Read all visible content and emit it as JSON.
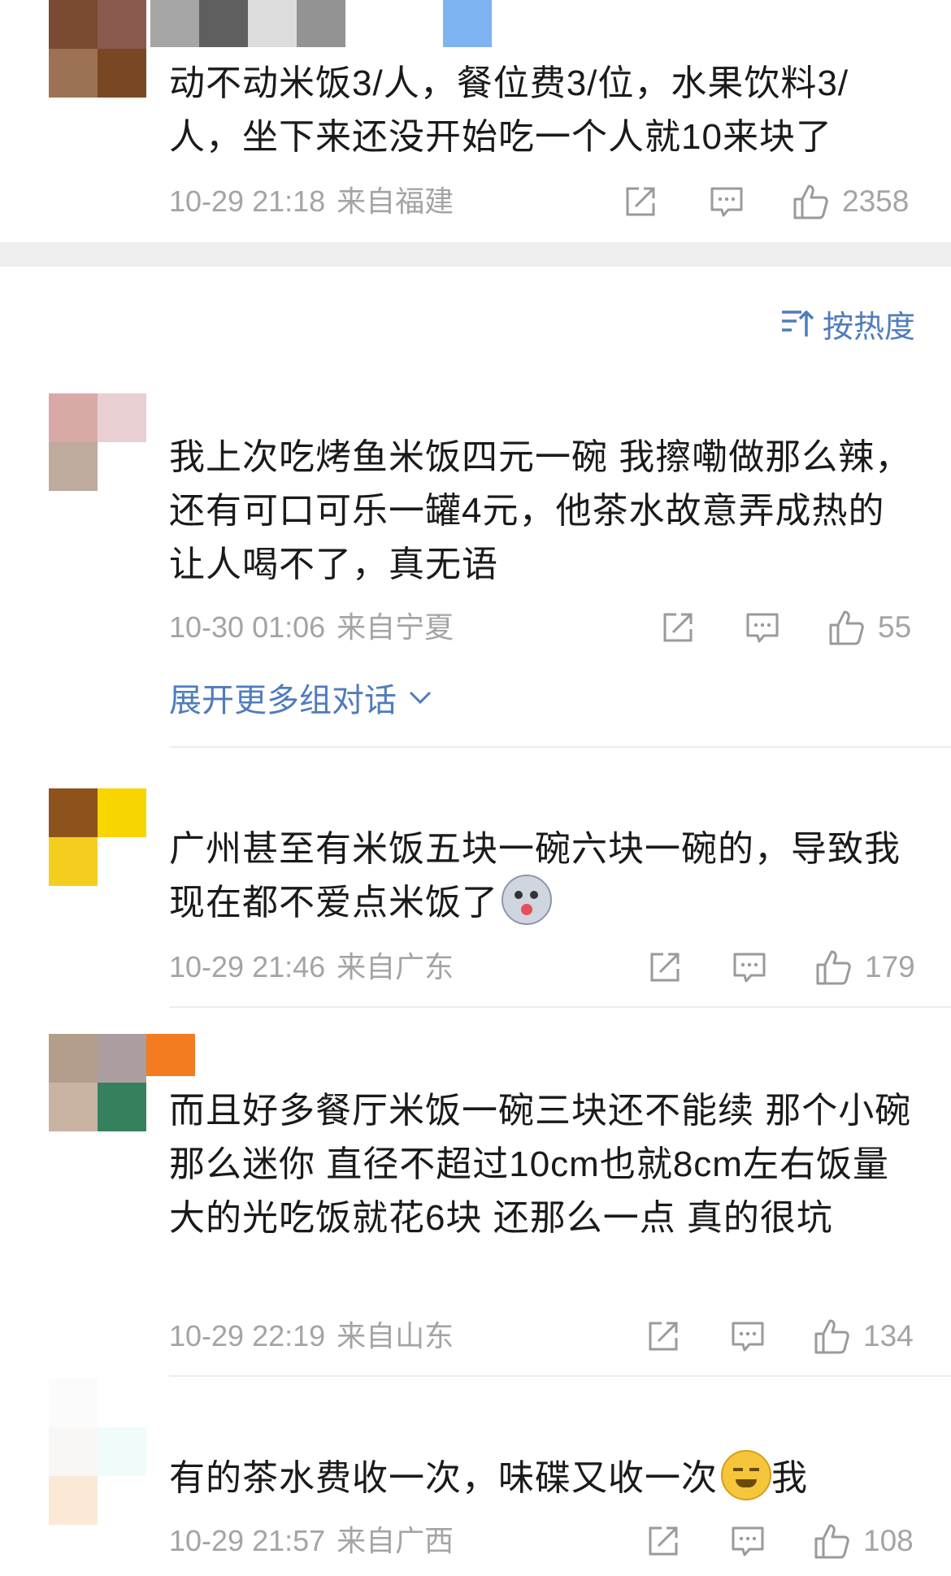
{
  "sort": {
    "label": "按热度",
    "icon": "sort-icon"
  },
  "expand_label": "展开更多组对话",
  "comments": [
    {
      "text": "动不动米饭3/人，餐位费3/位，水果饮料3/人，坐下来还没开始吃一个人就10来块了",
      "time": "10-29 21:18",
      "location": "来自福建",
      "likes": "2358"
    },
    {
      "text": "我上次吃烤鱼米饭四元一碗 我擦嘞做那么辣，还有可口可乐一罐4元，他茶水故意弄成热的让人喝不了，真无语",
      "time": "10-30 01:06",
      "location": "来自宁夏",
      "likes": "55"
    },
    {
      "text": "广州甚至有米饭五块一碗六块一碗的，导致我现在都不爱点米饭了",
      "emoji": "husky-emoji",
      "time": "10-29 21:46",
      "location": "来自广东",
      "likes": "179"
    },
    {
      "text": "而且好多餐厅米饭一碗三块还不能续 那个小碗那么迷你 直径不超过10cm也就8cm左右饭量大的光吃饭就花6块 还那么一点 真的很坑",
      "time": "10-29 22:19",
      "location": "来自山东",
      "likes": "134"
    },
    {
      "text_before": "有的茶水费收一次，味碟又收一次",
      "emoji": "sweat-smile-emoji",
      "text_after": "我",
      "time": "10-29 21:57",
      "location": "来自广西",
      "likes": "108"
    }
  ],
  "colors": {
    "link_blue": "#4f7cbc",
    "meta_gray": "#a4a4a4",
    "separator": "#efefef"
  }
}
